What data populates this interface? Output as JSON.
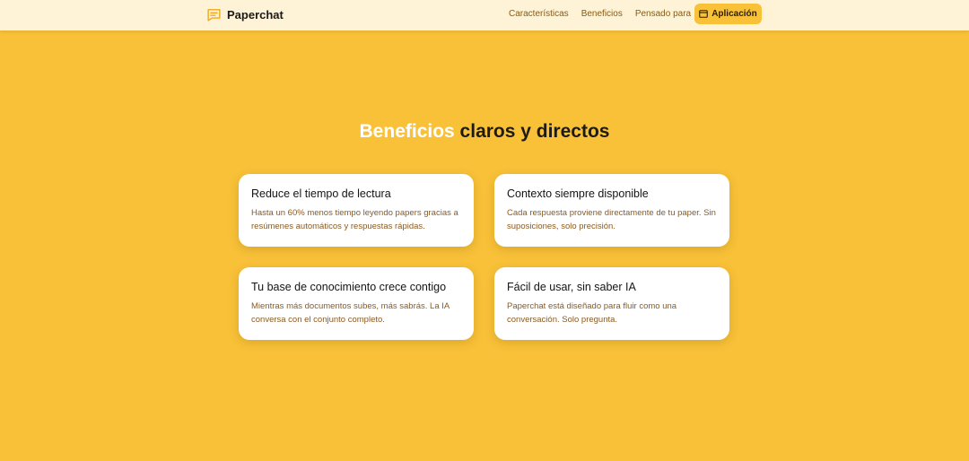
{
  "header": {
    "brand": "Paperchat",
    "nav": [
      "Características",
      "Beneficios",
      "Pensado para"
    ],
    "app_button": "Aplicación"
  },
  "section": {
    "title_accent": "Beneficios",
    "title_rest": " claros y directos"
  },
  "cards": [
    {
      "title": "Reduce el tiempo de lectura",
      "text": "Hasta un 60% menos tiempo leyendo papers gracias a resúmenes automáticos y respuestas rápidas."
    },
    {
      "title": "Contexto siempre disponible",
      "text": "Cada respuesta proviene directamente de tu paper. Sin suposiciones, solo precisión."
    },
    {
      "title": "Tu base de conocimiento crece contigo",
      "text": "Mientras más documentos subes, más sabrás. La IA conversa con el conjunto completo."
    },
    {
      "title": "Fácil de usar, sin saber IA",
      "text": "Paperchat está diseñado para fluir como una conversación. Solo pregunta."
    }
  ],
  "icons": {
    "brand": "chat-bubble-icon",
    "app_button": "window-icon"
  },
  "colors": {
    "background": "#f8c138",
    "navbar": "#fef3d6",
    "accent": "#ffffff",
    "nav_link": "#8a5a10",
    "card_text": "#8a5a22"
  }
}
